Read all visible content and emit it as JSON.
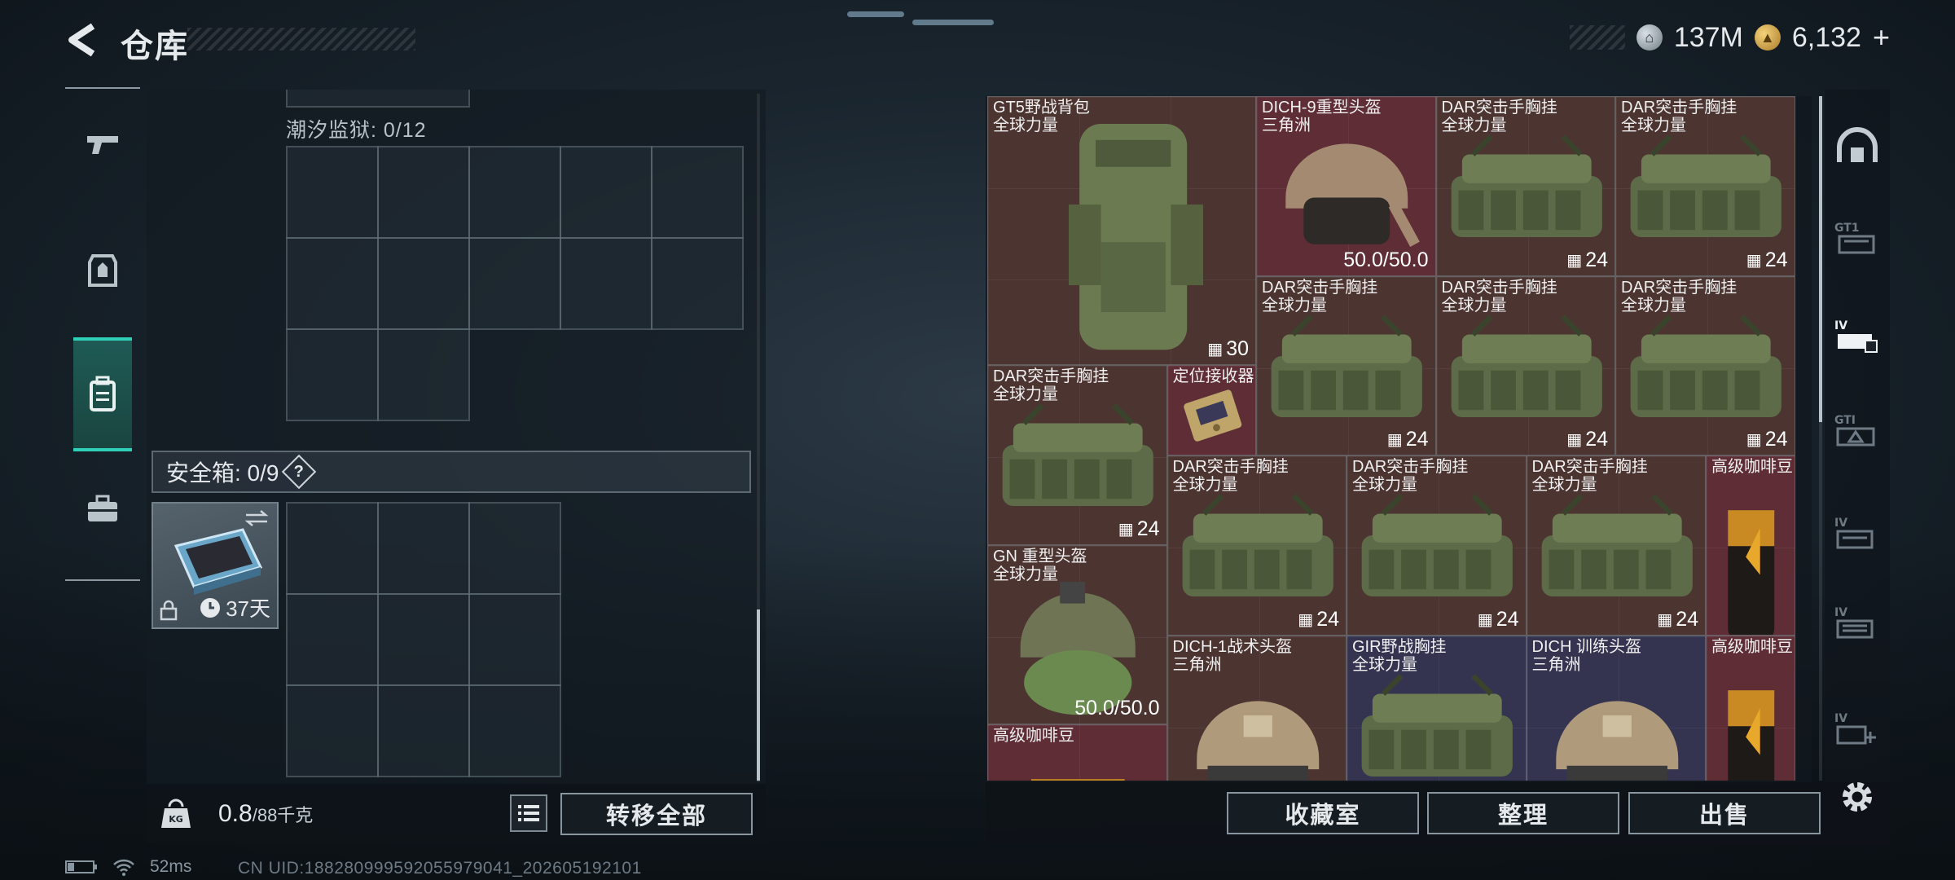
{
  "header": {
    "title": "仓库"
  },
  "currency": {
    "silver": "137M",
    "gold": "6,132",
    "plus": "+"
  },
  "storage": {
    "cage_label": "潮汐监狱: 0/12",
    "safe_label": "安全箱: 0/9",
    "safe_help": "?",
    "safe_item_days": "37天"
  },
  "left_bottom": {
    "weight_value": "0.8",
    "weight_unit": "/88千克",
    "transfer_all": "转移全部"
  },
  "inventory": {
    "items": [
      {
        "name": "GT5野战背包",
        "sub": "全球力量",
        "qty": "30",
        "color": "brown",
        "kind": "backpack"
      },
      {
        "name": "DICH-9重型头盔",
        "sub": "三角洲",
        "qty": "50.0/50.0",
        "color": "red",
        "kind": "helmet"
      },
      {
        "name": "DAR突击手胸挂",
        "sub": "全球力量",
        "qty": "24",
        "color": "brown",
        "kind": "rig"
      },
      {
        "name": "DAR突击手胸挂",
        "sub": "全球力量",
        "qty": "24",
        "color": "brown",
        "kind": "rig"
      },
      {
        "name": "DAR突击手胸挂",
        "sub": "全球力量",
        "qty": "24",
        "color": "brown",
        "kind": "rig"
      },
      {
        "name": "DAR突击手胸挂",
        "sub": "全球力量",
        "qty": "24",
        "color": "brown",
        "kind": "rig"
      },
      {
        "name": "DAR突击手胸挂",
        "sub": "全球力量",
        "qty": "24",
        "color": "brown",
        "kind": "rig"
      },
      {
        "name": "DAR突击手胸挂",
        "sub": "全球力量",
        "qty": "24",
        "color": "brown",
        "kind": "rig"
      },
      {
        "name": "定位接收器",
        "sub": "",
        "qty": "",
        "color": "red",
        "kind": "receiver"
      },
      {
        "name": "DAR突击手胸挂",
        "sub": "全球力量",
        "qty": "24",
        "color": "brown",
        "kind": "rig"
      },
      {
        "name": "DAR突击手胸挂",
        "sub": "全球力量",
        "qty": "24",
        "color": "brown",
        "kind": "rig"
      },
      {
        "name": "DAR突击手胸挂",
        "sub": "全球力量",
        "qty": "24",
        "color": "brown",
        "kind": "rig"
      },
      {
        "name": "高级咖啡豆",
        "sub": "",
        "qty": "",
        "color": "red",
        "kind": "coffee"
      },
      {
        "name": "GN 重型头盔",
        "sub": "全球力量",
        "qty": "50.0/50.0",
        "color": "brown",
        "kind": "helmet2"
      },
      {
        "name": "DICH-1战术头盔",
        "sub": "三角洲",
        "qty": "",
        "color": "brown",
        "kind": "helmet3"
      },
      {
        "name": "GIR野战胸挂",
        "sub": "全球力量",
        "qty": "",
        "color": "purple",
        "kind": "rig"
      },
      {
        "name": "DICH 训练头盔",
        "sub": "三角洲",
        "qty": "",
        "color": "purple",
        "kind": "helmet3"
      },
      {
        "name": "高级咖啡豆",
        "sub": "",
        "qty": "",
        "color": "red",
        "kind": "coffee"
      },
      {
        "name": "高级咖啡豆",
        "sub": "",
        "qty": "",
        "color": "red",
        "kind": "coffee"
      }
    ]
  },
  "actions": {
    "collection": "收藏室",
    "sort": "整理",
    "sell": "出售"
  },
  "status": {
    "ping": "52ms",
    "uid": "CN UID:1882809995920559790​41_202605192101"
  },
  "colors": {
    "accent": "#2ed1b8",
    "item_brown": "#4c3531",
    "item_red": "#5e2d36",
    "item_purple": "#353450"
  },
  "icons": {
    "nav": [
      "gun-icon",
      "armor-icon",
      "backpack-icon",
      "briefcase-icon"
    ],
    "rail": [
      "dome-icon",
      "rig-slot-icon",
      "vest-slot-icon",
      "helmet-slot-icon",
      "bag-slot-icon",
      "case-slot-icon",
      "add-slot-icon",
      "gear-icon"
    ]
  }
}
